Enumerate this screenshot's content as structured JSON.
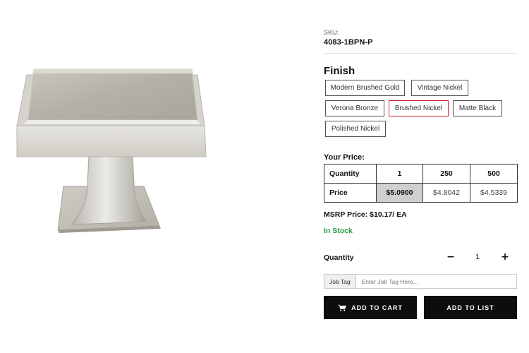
{
  "product": {
    "image_alt": "Square cabinet knob in brushed nickel",
    "sku_label": "SKU:",
    "sku": "4083-1BPN-P"
  },
  "finish": {
    "title": "Finish",
    "options": [
      {
        "label": "Modern Brushed Gold",
        "selected": false
      },
      {
        "label": "Vintage Nickel",
        "selected": false
      },
      {
        "label": "Verona Bronze",
        "selected": false
      },
      {
        "label": "Brushed Nickel",
        "selected": true
      },
      {
        "label": "Matte Black",
        "selected": false
      },
      {
        "label": "Polished Nickel",
        "selected": false
      }
    ],
    "selected_color": "#d0202e"
  },
  "pricing": {
    "title": "Your Price:",
    "headers": [
      "Quantity",
      "1",
      "250",
      "500"
    ],
    "row_label": "Price",
    "prices": [
      "$5.0900",
      "$4.8042",
      "$4.5339"
    ],
    "msrp": "MSRP Price: $10.17/ EA",
    "stock": "In Stock",
    "stock_color": "#1f9a3a"
  },
  "quantity": {
    "label": "Quantity",
    "value": "1",
    "minus": "−",
    "plus": "+"
  },
  "job_tag": {
    "label": "Job Tag",
    "placeholder": "Enter Job Tag Here..."
  },
  "actions": {
    "add_to_cart": "ADD TO CART",
    "add_to_list": "ADD TO LIST",
    "cart_icon": "cart-icon"
  }
}
